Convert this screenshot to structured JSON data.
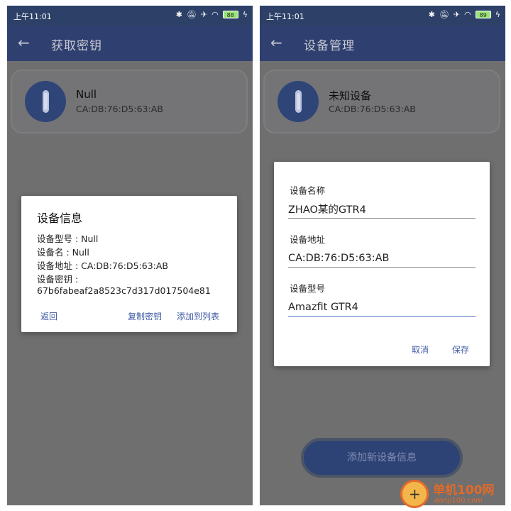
{
  "left": {
    "status": {
      "time": "上午11:01",
      "battery": "88"
    },
    "appbar": {
      "back": "←",
      "title": "获取密钥"
    },
    "device_card": {
      "name": "Null",
      "address": "CA:DB:76:D5:63:AB"
    },
    "dialog": {
      "title": "设备信息",
      "model_line": "设备型号 : Null",
      "name_line": "设备名 : Null",
      "address_line": "设备地址 : CA:DB:76:D5:63:AB",
      "key_label": "设备密钥 :",
      "key_value": "67b6fabeaf2a8523c7d317d017504e81",
      "back_label": "返回",
      "copy_label": "复制密钥",
      "add_label": "添加到列表"
    }
  },
  "right": {
    "status": {
      "time": "上午11:01",
      "battery": "89"
    },
    "appbar": {
      "back": "←",
      "title": "设备管理"
    },
    "device_card": {
      "name": "未知设备",
      "address": "CA:DB:76:D5:63:AB"
    },
    "dialog": {
      "name_label": "设备名称",
      "name_value": "ZHAO某的GTR4",
      "address_label": "设备地址",
      "address_value": "CA:DB:76:D5:63:AB",
      "model_label": "设备型号",
      "model_value": "Amazfit GTR4",
      "cancel_label": "取消",
      "save_label": "保存"
    },
    "add_button": "添加新设备信息"
  },
  "watermark": {
    "logo": "+",
    "title": "单机100网",
    "url": "danji100.com"
  },
  "colors": {
    "appbar": "#2f4070",
    "accent": "#3f5ba6",
    "overlay": "#6f6f70"
  }
}
